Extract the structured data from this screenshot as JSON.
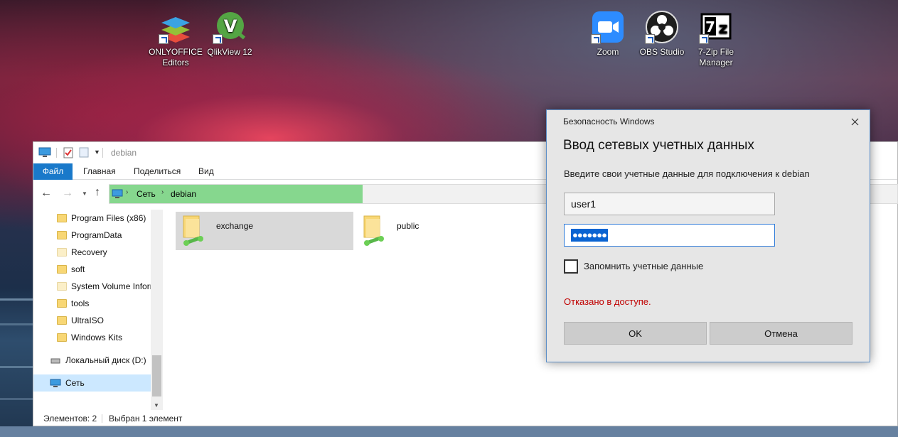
{
  "desktop": {
    "icons": [
      {
        "label": "ONLYOFFICE Editors",
        "icon": "onlyoffice-icon"
      },
      {
        "label": "QlikView 12",
        "icon": "qlikview-icon"
      },
      {
        "label": "Zoom",
        "icon": "zoom-icon"
      },
      {
        "label": "OBS Studio",
        "icon": "obs-icon"
      },
      {
        "label": "7-Zip File Manager",
        "icon": "7zip-icon"
      }
    ]
  },
  "explorer": {
    "window_title": "debian",
    "ribbon_tabs": [
      {
        "label": "Файл"
      },
      {
        "label": "Главная"
      },
      {
        "label": "Поделиться"
      },
      {
        "label": "Вид"
      }
    ],
    "breadcrumb": [
      "Сеть",
      "debian"
    ],
    "tree": [
      {
        "label": "Program Files (x86)"
      },
      {
        "label": "ProgramData"
      },
      {
        "label": "Recovery"
      },
      {
        "label": "soft"
      },
      {
        "label": "System Volume Information"
      },
      {
        "label": "tools"
      },
      {
        "label": "UltraISO"
      },
      {
        "label": "Windows Kits"
      },
      {
        "label": "Локальный диск (D:)"
      },
      {
        "label": "Сеть"
      }
    ],
    "items": [
      {
        "name": "exchange",
        "selected": true
      },
      {
        "name": "public",
        "selected": false
      }
    ],
    "status": {
      "count": "Элементов: 2",
      "selection": "Выбран 1 элемент"
    }
  },
  "dialog": {
    "caption": "Безопасность Windows",
    "title": "Ввод сетевых учетных данных",
    "prompt": "Введите свои учетные данные для подключения к debian",
    "username": "user1",
    "password_mask": "●●●●●●●",
    "remember_label": "Запомнить учетные данные",
    "remember_checked": false,
    "error": "Отказано в доступе.",
    "ok_label": "OK",
    "cancel_label": "Отмена",
    "accent_color": "#0a64d2",
    "error_color": "#c00000"
  }
}
